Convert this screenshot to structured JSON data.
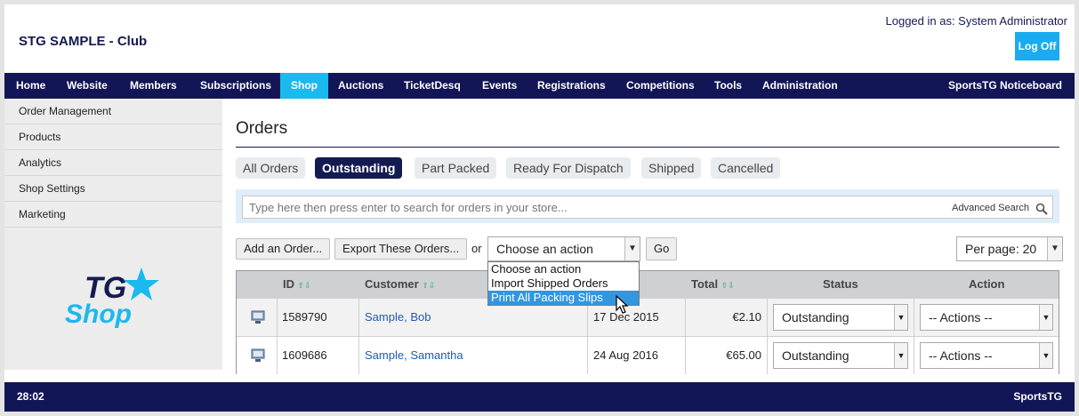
{
  "header": {
    "site_title": "STG SAMPLE - Club",
    "logged_in": "Logged in as: System Administrator",
    "logoff_label": "Log Off"
  },
  "nav": {
    "items": [
      "Home",
      "Website",
      "Members",
      "Subscriptions",
      "Shop",
      "Auctions",
      "TicketDesq",
      "Events",
      "Registrations",
      "Competitions",
      "Tools",
      "Administration"
    ],
    "active": "Shop",
    "right_label": "SportsTG Noticeboard"
  },
  "sidebar": {
    "items": [
      "Order Management",
      "Products",
      "Analytics",
      "Shop Settings",
      "Marketing"
    ],
    "logo_text_1": "TG",
    "logo_text_2": "Shop"
  },
  "main": {
    "title": "Orders",
    "tabs": [
      "All Orders",
      "Outstanding",
      "Part Packed",
      "Ready For Dispatch",
      "Shipped",
      "Cancelled"
    ],
    "active_tab": "Outstanding",
    "search": {
      "placeholder": "Type here then press enter to search for orders in your store...",
      "advanced_label": "Advanced Search"
    },
    "toolbar": {
      "add_order": "Add an Order...",
      "export_orders": "Export These Orders...",
      "or_text": "or",
      "action_select": "Choose an action",
      "go_label": "Go",
      "per_page": "Per page: 20"
    },
    "action_dropdown": {
      "options": [
        "Choose an action",
        "Import Shipped Orders",
        "Print All Packing Slips"
      ],
      "highlighted": "Print All Packing Slips"
    },
    "table": {
      "columns": [
        "ID",
        "Customer",
        "Total",
        "Status",
        "Action"
      ],
      "rows": [
        {
          "id": "1589790",
          "first": "Sample,",
          "last": "Bob",
          "date": "17 Dec 2015",
          "total": "€2.10",
          "status": "Outstanding",
          "action": "-- Actions --"
        },
        {
          "id": "1609686",
          "first": "Sample,",
          "last": "Samantha",
          "date": "24 Aug 2016",
          "total": "€65.00",
          "status": "Outstanding",
          "action": "-- Actions --"
        }
      ]
    }
  },
  "footer": {
    "left": "28:02",
    "right": "SportsTG"
  },
  "colors": {
    "navy": "#121656",
    "accent": "#1ab9ee",
    "link": "#1f5ab0",
    "sort": "#33a36e"
  }
}
